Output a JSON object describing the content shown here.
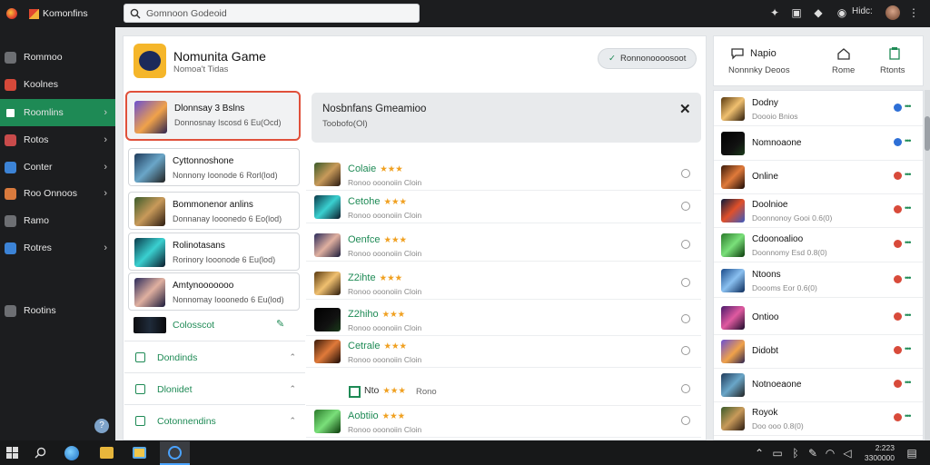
{
  "app": {
    "title": "Komonfins"
  },
  "search": {
    "placeholder": "Gomnoon Godeoid"
  },
  "topbar": {
    "user": "Hidc:"
  },
  "sidebar": {
    "items": [
      {
        "label": "Rommoo",
        "icon": "chat-icon",
        "color": "#6d6f73",
        "chevron": false,
        "active": false
      },
      {
        "label": "Koolnes",
        "icon": "record-icon",
        "color": "#d6493a",
        "chevron": false,
        "active": false
      },
      {
        "label": "Roomlins",
        "icon": "store-icon",
        "color": "#ffffff",
        "chevron": true,
        "active": true
      },
      {
        "label": "Rotos",
        "icon": "image-icon",
        "color": "#c94b4b",
        "chevron": true,
        "active": false
      },
      {
        "label": "Conter",
        "icon": "window-icon",
        "color": "#3c83d6",
        "chevron": true,
        "active": false
      },
      {
        "label": "Roo Onnoos",
        "icon": "folder-icon",
        "color": "#d97a3d",
        "chevron": true,
        "active": false
      },
      {
        "label": "Ramo",
        "icon": "headset-icon",
        "color": "#6d6f73",
        "chevron": false,
        "active": false
      },
      {
        "label": "Rotres",
        "icon": "grid-icon",
        "color": "#3c83d6",
        "chevron": true,
        "active": false
      },
      {
        "label": "Rootins",
        "icon": "gear-icon",
        "color": "#6d6f73",
        "chevron": false,
        "active": false
      }
    ]
  },
  "main": {
    "title": "Nomunita Game",
    "subtitle": "Nomoa't Tidas",
    "pill": "Ronnonoooosoot"
  },
  "left_list": {
    "cards": [
      {
        "title": "Dlonnsay 3 Bslns",
        "subtitle": "Donnosnay Iscosd 6 Eu(Ocd)",
        "selected": true
      },
      {
        "title": "Cyttonnoshone",
        "subtitle": "Nonnony Ioonode 6 Rorl(lod)",
        "selected": false
      },
      {
        "title": "Bommonenor anlins",
        "subtitle": "Donnanay Iooonedo 6 Eo(lod)",
        "selected": false
      },
      {
        "title": "Rolinotasans",
        "subtitle": "Rorinory Iooonode 6 Eu(lod)",
        "selected": false
      },
      {
        "title": "Amtynooooooo",
        "subtitle": "Nonnomay Iooonedo 6 Eu(lod)",
        "selected": false
      }
    ],
    "bar_label": "Colosscot",
    "sections": [
      "Dondinds",
      "Dlonidet",
      "Cotonnendins"
    ]
  },
  "banner": {
    "title": "Nosbnfans Gmeamioo",
    "subtitle": "Toobofo(Ol)"
  },
  "middle_list": {
    "rows": [
      {
        "title": "Colaie",
        "stars": "★★★",
        "subtitle": "Ronoo ooonoiin Cloin"
      },
      {
        "title": "Cetohe",
        "stars": "★★★",
        "subtitle": "Ronoo ooonoiin Cloin"
      },
      {
        "title": "Oenfce",
        "stars": "★★★",
        "subtitle": "Ronoo ooonoiin Cloin"
      },
      {
        "title": "Z2ihte",
        "stars": "★★★",
        "subtitle": "Ronoo ooonoiin Cloin"
      },
      {
        "title": "Z2hiho",
        "stars": "★★★",
        "subtitle": "Ronoo ooonoiin Cloin"
      },
      {
        "title": "Cetrale",
        "stars": "★★★",
        "subtitle": "Ronoo ooonoiin Cloin"
      },
      {
        "title": "Nto",
        "stars": "★★★",
        "subtitle": "Rono",
        "plain": true
      },
      {
        "title": "Aobtiio",
        "stars": "★★★",
        "subtitle": "Ronoo ooonoiin Cloin"
      }
    ]
  },
  "right_panel": {
    "header": {
      "title": "Napio",
      "items": [
        {
          "label": "Nonnnky Deoos",
          "icon": "chat-icon"
        },
        {
          "label": "Rome",
          "icon": "home-icon"
        },
        {
          "label": "Rtonts",
          "icon": "clipboard-icon"
        }
      ]
    },
    "rows": [
      {
        "title": "Dodny",
        "subtitle": "Doooio Bnios",
        "dot": "#2e6fd6"
      },
      {
        "title": "Nomnoaone",
        "subtitle": "",
        "dot": "#2e6fd6"
      },
      {
        "title": "Online",
        "subtitle": "",
        "dot": "#d84a3a"
      },
      {
        "title": "Doolnioe",
        "subtitle": "Doonnonoy Gooi 0.6(0)",
        "dot": "#d84a3a"
      },
      {
        "title": "Cdoonoalioo",
        "subtitle": "Doonnomy Esd 0.8(0)",
        "dot": "#d84a3a"
      },
      {
        "title": "Ntoons",
        "subtitle": "Doooms Eor 0.6(0)",
        "dot": "#d84a3a"
      },
      {
        "title": "Ontioo",
        "subtitle": "",
        "dot": "#d84a3a"
      },
      {
        "title": "Didobt",
        "subtitle": "",
        "dot": "#d84a3a"
      },
      {
        "title": "Notnoeaone",
        "subtitle": "",
        "dot": "#d84a3a"
      },
      {
        "title": "Royok",
        "subtitle": "Doo ooo 0.8(0)",
        "dot": "#d84a3a"
      }
    ]
  },
  "taskbar": {
    "time": "2:223",
    "date": "3300000"
  },
  "colors": {
    "accent": "#1e8a55",
    "highlight": "#e0503a"
  }
}
